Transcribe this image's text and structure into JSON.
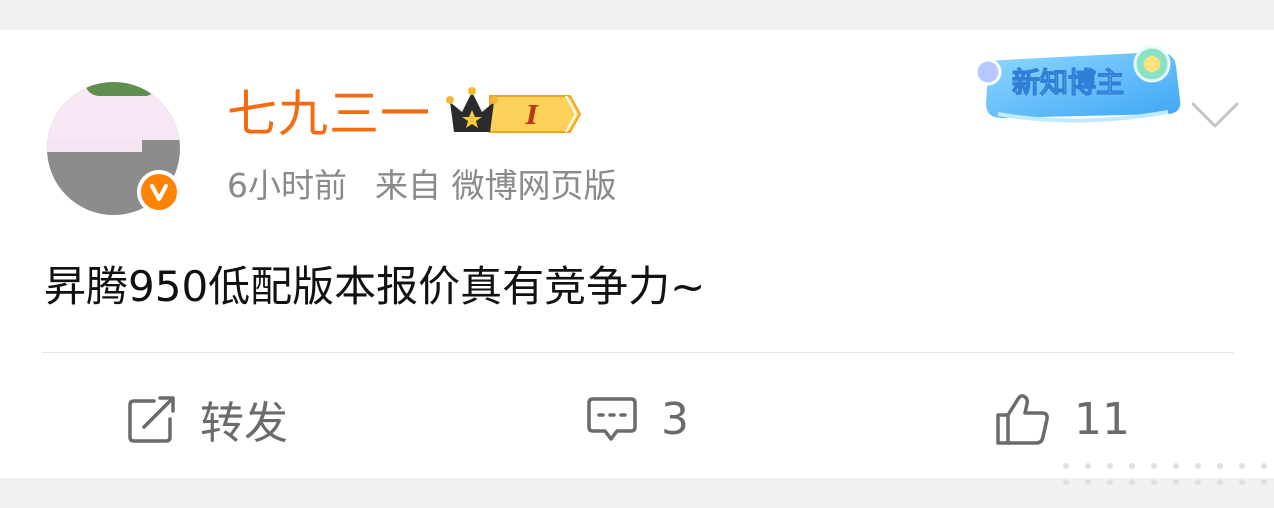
{
  "post": {
    "username": "七九三一",
    "time": "6小时前",
    "source": "来自 微博网页版",
    "content": "昇腾950低配版本报价真有竞争力~",
    "badge_label": "新知博主",
    "level_label": "I"
  },
  "actions": {
    "repost_label": "转发",
    "comment_count": "3",
    "like_count": "11"
  },
  "colors": {
    "username": "#f46b10",
    "verified": "#ff8200",
    "text": "#111111",
    "meta": "#8a8a8a"
  },
  "icons": [
    "verified-icon",
    "crown-level-icon",
    "new-knowledge-blogger-badge",
    "chevron-down-icon",
    "repost-icon",
    "comment-icon",
    "like-icon"
  ]
}
